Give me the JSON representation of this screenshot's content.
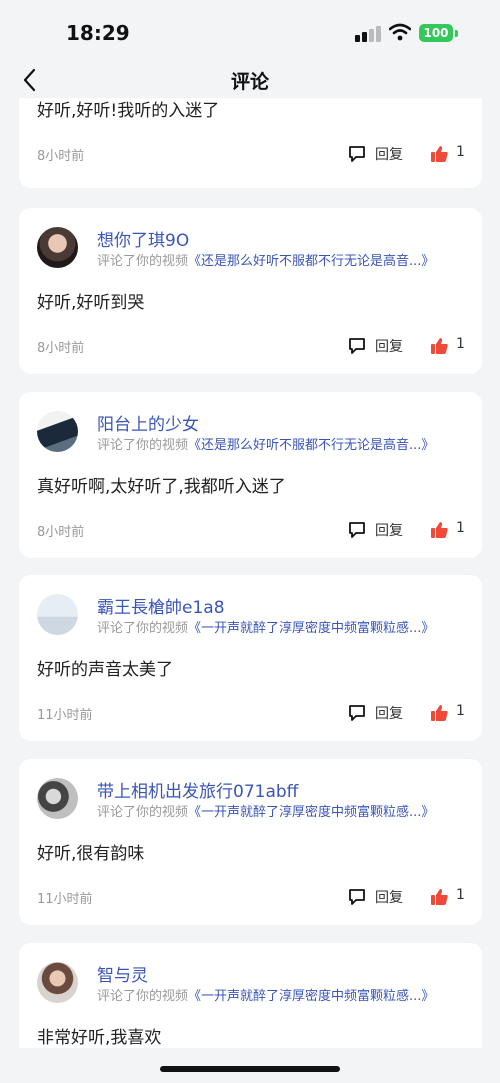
{
  "status_bar": {
    "time": "18:29",
    "battery": "100"
  },
  "nav": {
    "title": "评论",
    "back_icon": "chevron-left-icon"
  },
  "actions": {
    "reply_label": "回复",
    "reply_icon": "comment-bubble-icon",
    "like_icon": "thumbs-up-icon"
  },
  "colors": {
    "accent": "#3a55b8",
    "like": "#ee4a3a",
    "battery": "#34c759"
  },
  "comments": [
    {
      "comment": "好听,好听!我听的入迷了",
      "time": "8小时前",
      "likes": "1"
    },
    {
      "username": "想你了琪9O",
      "prefix": "评论了你的视频",
      "video": "《还是那么好听不服都不行无论是高音...》",
      "comment": "好听,好听到哭",
      "time": "8小时前",
      "likes": "1"
    },
    {
      "username": "阳台上的少女",
      "prefix": "评论了你的视频",
      "video": "《还是那么好听不服都不行无论是高音...》",
      "comment": "真好听啊,太好听了,我都听入迷了",
      "time": "8小时前",
      "likes": "1"
    },
    {
      "username": "霸王長槍帥e1a8",
      "prefix": "评论了你的视频",
      "video": "《一开声就醉了淳厚密度中频富颗粒感...》",
      "comment": "好听的声音太美了",
      "time": "11小时前",
      "likes": "1"
    },
    {
      "username": "带上相机出发旅行071abff",
      "prefix": "评论了你的视频",
      "video": "《一开声就醉了淳厚密度中频富颗粒感...》",
      "comment": "好听,很有韵味",
      "time": "11小时前",
      "likes": "1"
    },
    {
      "username": "智与灵",
      "prefix": "评论了你的视频",
      "video": "《一开声就醉了淳厚密度中频富颗粒感...》",
      "comment": "非常好听,我喜欢"
    }
  ]
}
